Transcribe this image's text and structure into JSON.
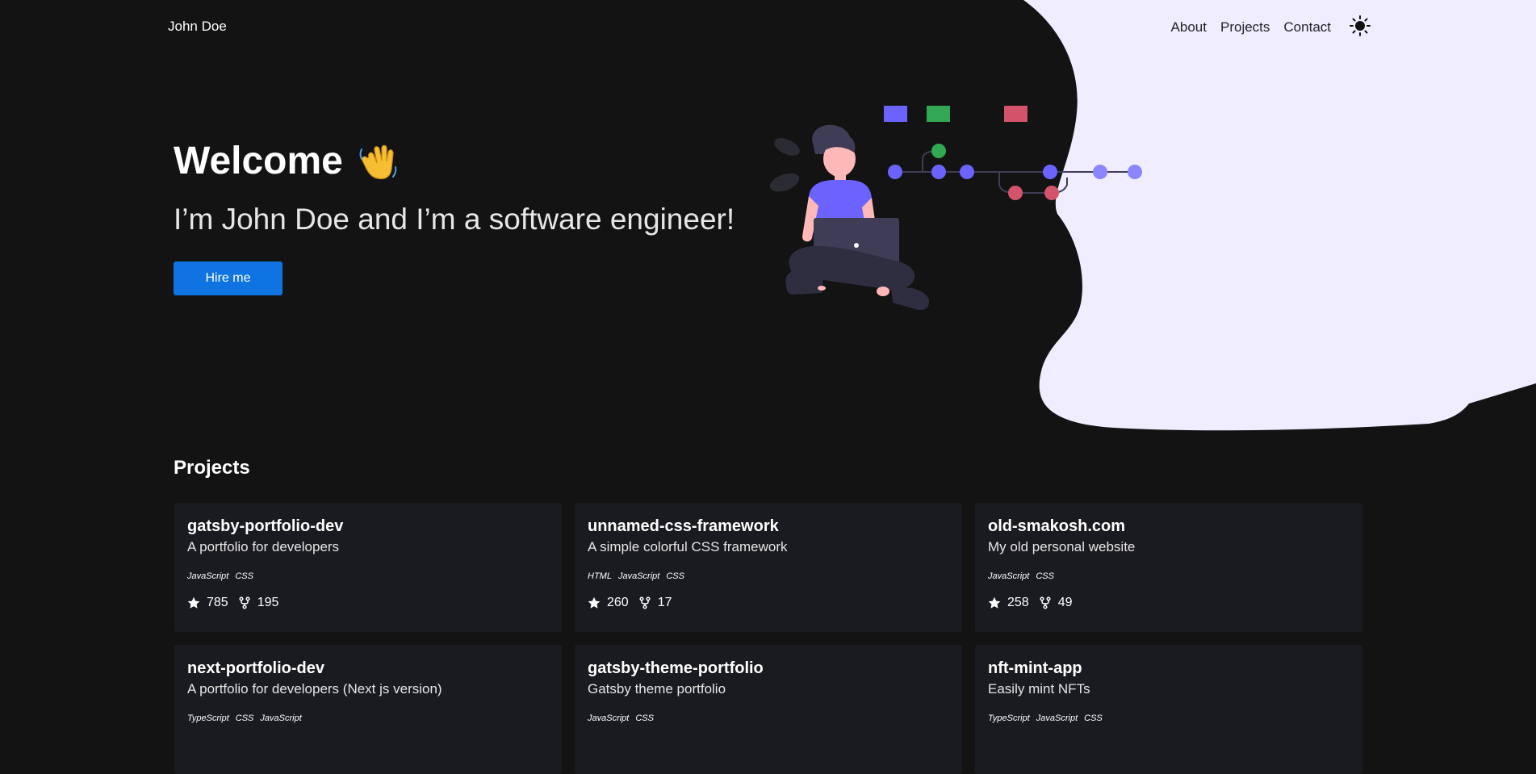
{
  "nav": {
    "brand": "John Doe",
    "links": [
      {
        "label": "About"
      },
      {
        "label": "Projects"
      },
      {
        "label": "Contact"
      }
    ],
    "theme_icon": "sun-icon"
  },
  "hero": {
    "title": "Welcome",
    "emoji": "waving-hand-icon",
    "subtitle": "I’m John Doe and I’m a software engineer!",
    "cta_label": "Hire me"
  },
  "projects": {
    "heading": "Projects",
    "items": [
      {
        "name": "gatsby-portfolio-dev",
        "description": "A portfolio for developers",
        "languages": [
          "JavaScript",
          "CSS"
        ],
        "stars": "785",
        "forks": "195"
      },
      {
        "name": "unnamed-css-framework",
        "description": "A simple colorful CSS framework",
        "languages": [
          "HTML",
          "JavaScript",
          "CSS"
        ],
        "stars": "260",
        "forks": "17"
      },
      {
        "name": "old-smakosh.com",
        "description": "My old personal website",
        "languages": [
          "JavaScript",
          "CSS"
        ],
        "stars": "258",
        "forks": "49"
      },
      {
        "name": "next-portfolio-dev",
        "description": "A portfolio for developers (Next js version)",
        "languages": [
          "TypeScript",
          "CSS",
          "JavaScript"
        ],
        "stars": "",
        "forks": ""
      },
      {
        "name": "gatsby-theme-portfolio",
        "description": "Gatsby theme portfolio",
        "languages": [
          "JavaScript",
          "CSS"
        ],
        "stars": "",
        "forks": ""
      },
      {
        "name": "nft-mint-app",
        "description": "Easily mint NFTs",
        "languages": [
          "TypeScript",
          "JavaScript",
          "CSS"
        ],
        "stars": "",
        "forks": ""
      }
    ]
  },
  "colors": {
    "background": "#131313",
    "blob": "#efedff",
    "accent_blue": "#0f74e1",
    "card": "#1a1b20",
    "illus_purple": "#6c63ff",
    "illus_green": "#32a852",
    "illus_red": "#d3546a"
  }
}
